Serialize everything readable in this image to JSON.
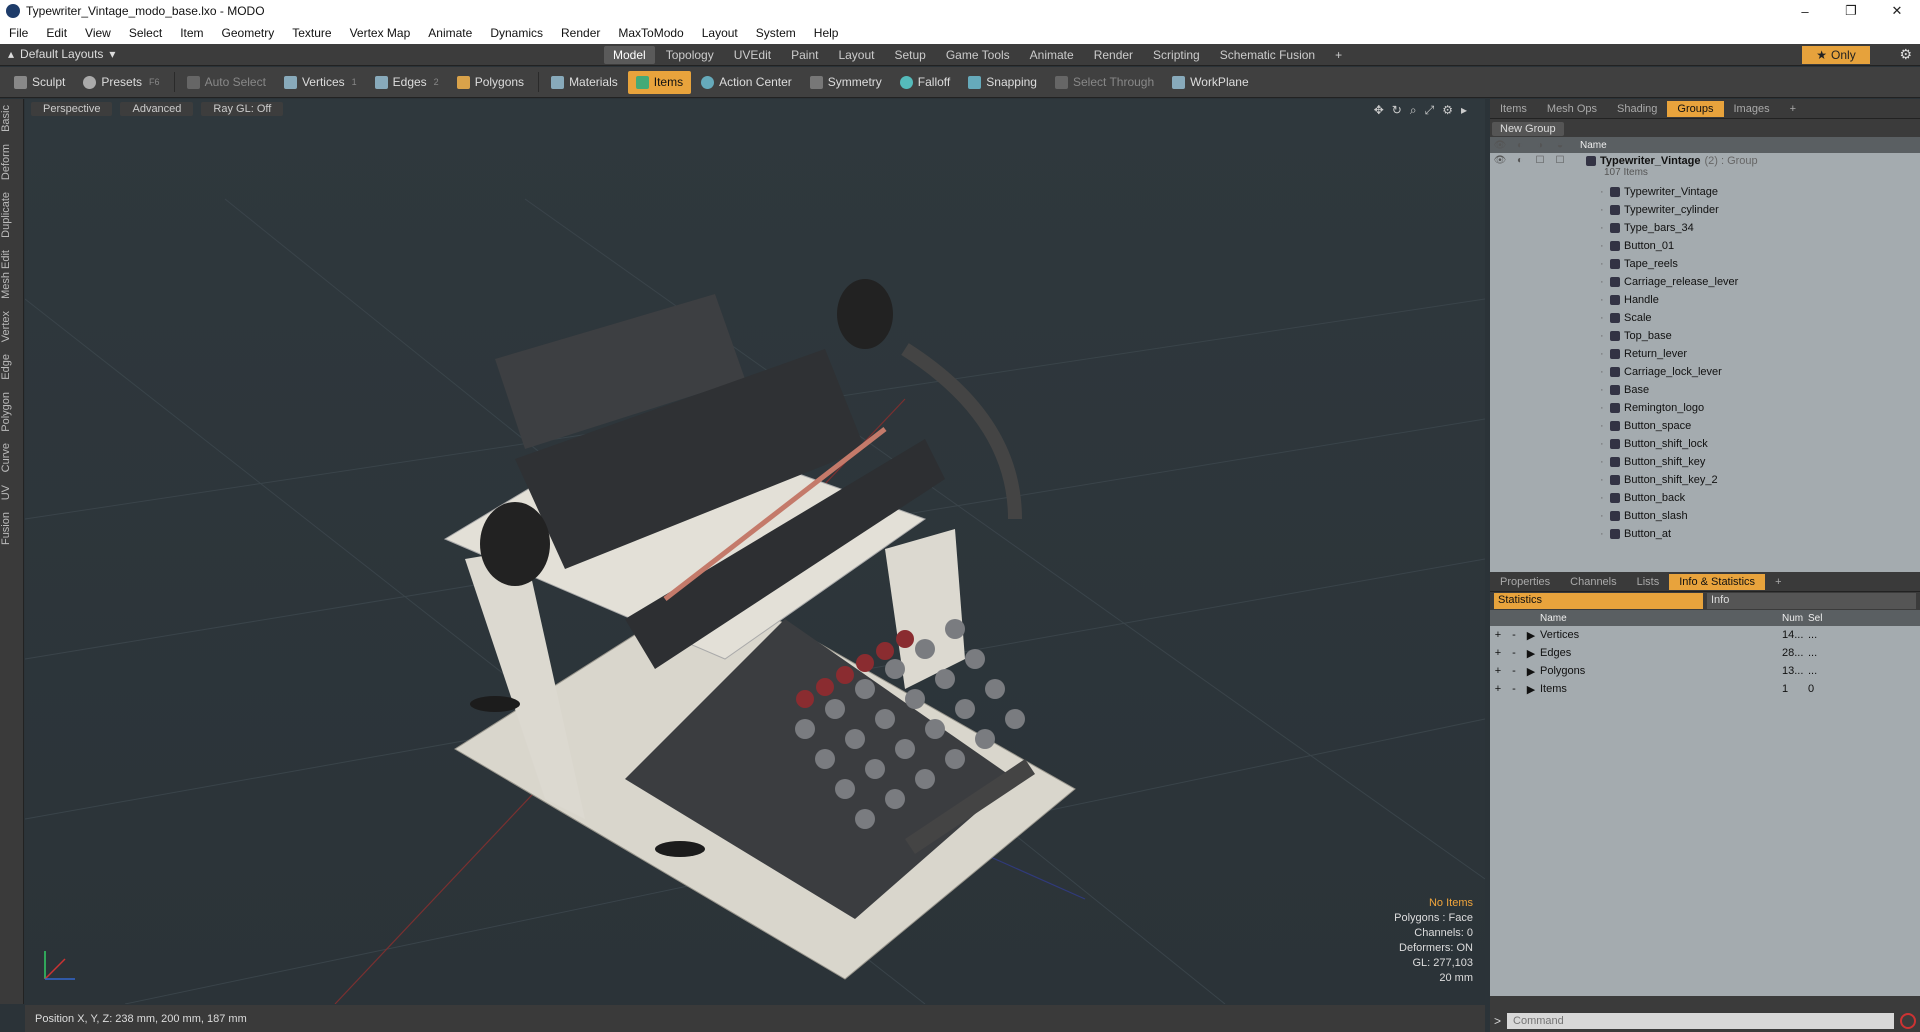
{
  "window": {
    "title": "Typewriter_Vintage_modo_base.lxo - MODO",
    "controls": [
      "–",
      "❐",
      "✕"
    ]
  },
  "menu": [
    "File",
    "Edit",
    "View",
    "Select",
    "Item",
    "Geometry",
    "Texture",
    "Vertex Map",
    "Animate",
    "Dynamics",
    "Render",
    "MaxToModo",
    "Layout",
    "System",
    "Help"
  ],
  "layout": {
    "label": "Default Layouts"
  },
  "mode_tabs": [
    "Model",
    "Topology",
    "UVEdit",
    "Paint",
    "Layout",
    "Setup",
    "Game Tools",
    "Animate",
    "Render",
    "Scripting",
    "Schematic Fusion"
  ],
  "active_mode": "Model",
  "only_label": "Only",
  "toolbar": {
    "sculpt": "Sculpt",
    "presets": "Presets",
    "presets_key": "F6",
    "auto_select": "Auto Select",
    "vertices": "Vertices",
    "vertices_num": "1",
    "edges": "Edges",
    "edges_num": "2",
    "polygons": "Polygons",
    "materials": "Materials",
    "items": "Items",
    "action_center": "Action Center",
    "symmetry": "Symmetry",
    "falloff": "Falloff",
    "snapping": "Snapping",
    "select_through": "Select Through",
    "workplane": "WorkPlane"
  },
  "side_tabs": [
    "Basic",
    "Deform",
    "Duplicate",
    "Mesh Edit",
    "Vertex",
    "Edge",
    "Polygon",
    "Curve",
    "UV",
    "Fusion"
  ],
  "viewport": {
    "perspective": "Perspective",
    "advanced": "Advanced",
    "raygl": "Ray GL: Off",
    "info": {
      "no_items": "No Items",
      "polygons": "Polygons : Face",
      "channels": "Channels: 0",
      "deformers": "Deformers: ON",
      "gl": "GL: 277,103",
      "scale": "20 mm"
    }
  },
  "status": {
    "position": "Position X, Y, Z:   238 mm, 200 mm, 187 mm"
  },
  "panel_tabs": [
    "Items",
    "Mesh Ops",
    "Shading",
    "Groups",
    "Images"
  ],
  "active_panel_tab": "Groups",
  "groups": {
    "new_group": "New Group",
    "col_name": "Name",
    "root": {
      "name": "Typewriter_Vintage",
      "suffix": "(2) : Group",
      "count": "107 Items"
    },
    "items": [
      "Typewriter_Vintage",
      "Typewriter_cylinder",
      "Type_bars_34",
      "Button_01",
      "Tape_reels",
      "Carriage_release_lever",
      "Handle",
      "Scale",
      "Top_base",
      "Return_lever",
      "Carriage_lock_lever",
      "Base",
      "Remington_logo",
      "Button_space",
      "Button_shift_lock",
      "Button_shift_key",
      "Button_shift_key_2",
      "Button_back",
      "Button_slash",
      "Button_at"
    ]
  },
  "bottom_tabs": [
    "Properties",
    "Channels",
    "Lists",
    "Info & Statistics"
  ],
  "active_bottom_tab": "Info & Statistics",
  "stats": {
    "statistics": "Statistics",
    "info": "Info",
    "col_name": "Name",
    "col_num": "Num",
    "col_sel": "Sel",
    "rows": [
      {
        "name": "Vertices",
        "num": "14...",
        "sel": "..."
      },
      {
        "name": "Edges",
        "num": "28...",
        "sel": "..."
      },
      {
        "name": "Polygons",
        "num": "13...",
        "sel": "..."
      },
      {
        "name": "Items",
        "num": "1",
        "sel": "0"
      }
    ]
  },
  "command": {
    "placeholder": "Command"
  },
  "colors": {
    "accent": "#e8a33c",
    "viewport_bg": "#2b3338",
    "list_bg": "#a4abaf"
  }
}
